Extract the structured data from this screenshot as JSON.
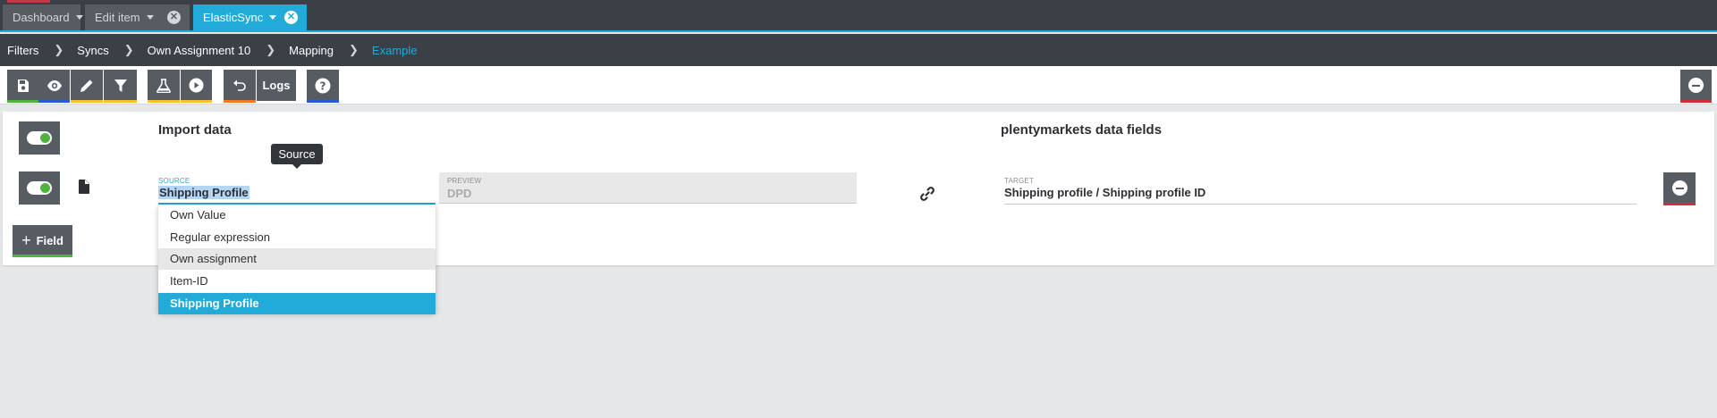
{
  "tabs": [
    {
      "label": "Dashboard",
      "closable": false,
      "active": false
    },
    {
      "label": "Edit item",
      "closable": true,
      "active": false
    },
    {
      "label": "ElasticSync",
      "closable": true,
      "active": true
    }
  ],
  "breadcrumb": [
    "Filters",
    "Syncs",
    "Own Assignment 10",
    "Mapping",
    "Example"
  ],
  "toolbar": {
    "logs_label": "Logs",
    "buttons": [
      {
        "icon": "save-icon",
        "accent": "#4fb33d"
      },
      {
        "icon": "eye-icon",
        "accent": "#2a5bd7"
      },
      {
        "icon": "pencil-icon",
        "accent": "#f5c233"
      },
      {
        "icon": "filter-icon",
        "accent": "#f5c233"
      },
      {
        "icon": "flask-icon",
        "accent": "#f5c233"
      },
      {
        "icon": "play-icon",
        "accent": "#f5c233"
      },
      {
        "icon": "undo-icon",
        "accent": "#f07a25"
      },
      {
        "icon": "help-icon",
        "accent": "#2a5bd7"
      },
      {
        "icon": "minus-circle-icon",
        "accent": "#d12e3b"
      }
    ]
  },
  "mapping": {
    "import_title": "Import data",
    "target_title": "plentymarkets data fields",
    "tooltip": "Source",
    "source": {
      "label": "SOURCE",
      "value": "Shipping Profile"
    },
    "preview": {
      "label": "PREVIEW",
      "value": "DPD"
    },
    "target": {
      "label": "TARGET",
      "value": "Shipping profile / Shipping profile ID"
    },
    "options": [
      "Own Value",
      "Regular expression",
      "Own assignment",
      "Item-ID",
      "Shipping Profile"
    ],
    "hovered_option": "Own assignment",
    "selected_option": "Shipping Profile",
    "add_field_label": "Field"
  },
  "colors": {
    "accent": "#22aad8",
    "toggle_on": "#4fb33d",
    "button_bg": "#575b62",
    "header_bg": "#3b3f46"
  }
}
